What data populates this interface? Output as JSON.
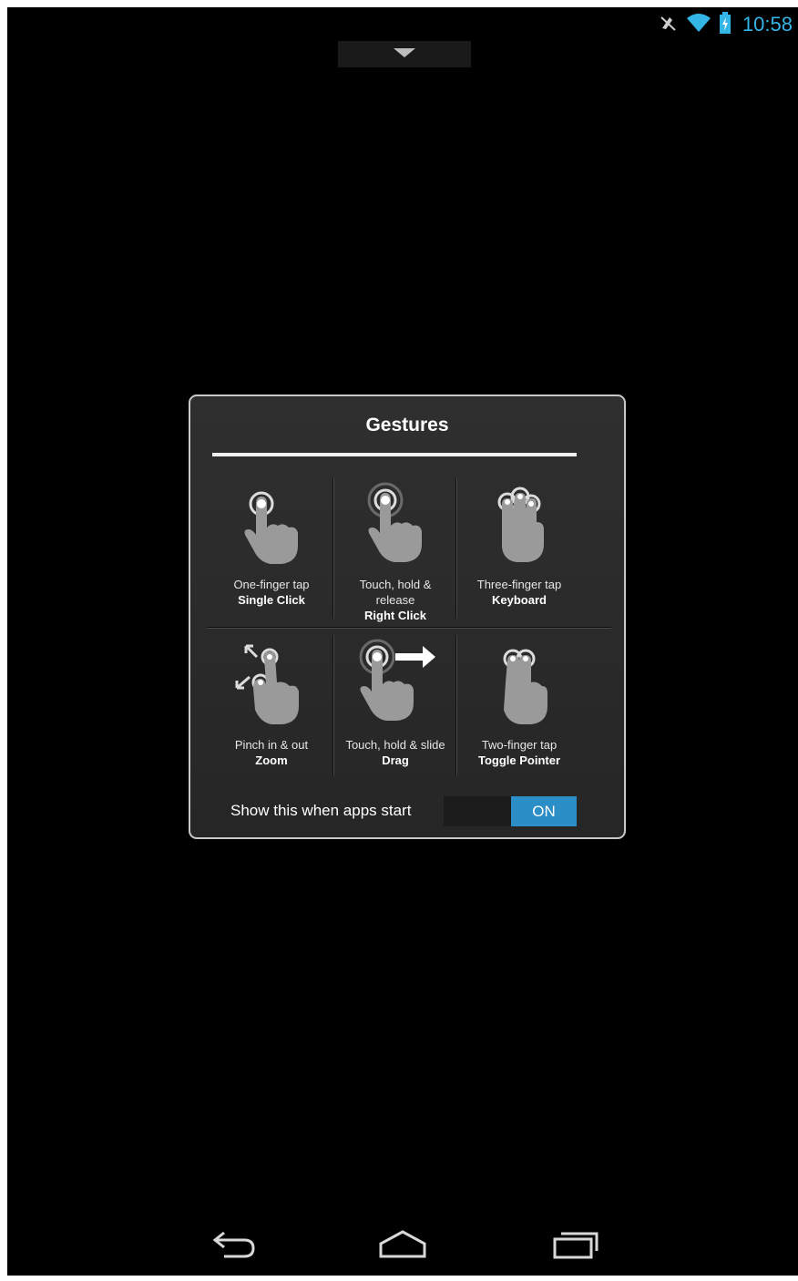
{
  "status_bar": {
    "time": "10:58",
    "icons": [
      "mute-icon",
      "wifi-icon",
      "battery-charging-icon"
    ],
    "accent_color": "#33b5e5"
  },
  "dialog": {
    "title": "Gestures",
    "gestures": [
      {
        "icon": "one-finger-tap-icon",
        "gesture": "One-finger tap",
        "action": "Single Click"
      },
      {
        "icon": "touch-hold-release-icon",
        "gesture": "Touch, hold & release",
        "action": "Right Click"
      },
      {
        "icon": "three-finger-tap-icon",
        "gesture": "Three-finger tap",
        "action": "Keyboard"
      },
      {
        "icon": "pinch-icon",
        "gesture": "Pinch in & out",
        "action": "Zoom"
      },
      {
        "icon": "touch-hold-slide-icon",
        "gesture": "Touch, hold & slide",
        "action": "Drag"
      },
      {
        "icon": "two-finger-tap-icon",
        "gesture": "Two-finger tap",
        "action": "Toggle Pointer"
      }
    ],
    "show_label": "Show this when apps start",
    "toggle": {
      "state": "ON",
      "color": "#2b8ec6"
    }
  },
  "nav_bar": {
    "icons": [
      "back-icon",
      "home-icon",
      "recent-apps-icon"
    ]
  }
}
